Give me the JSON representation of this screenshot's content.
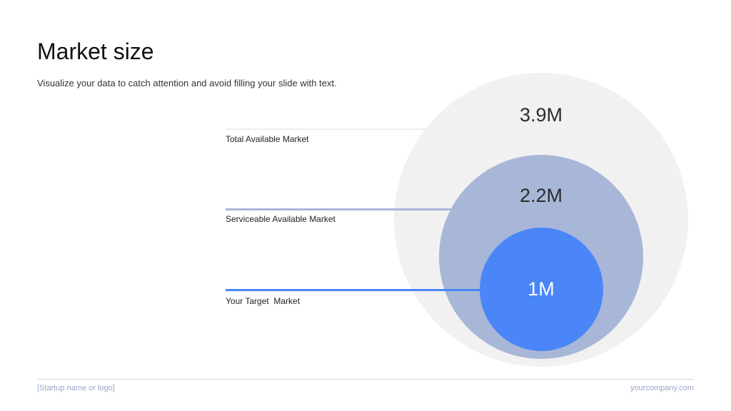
{
  "slide": {
    "title": "Market size",
    "subtitle": "Visualize your data to catch attention and avoid filling your slide with text."
  },
  "markets": [
    {
      "label": "Total Available Market",
      "value": "3.9M",
      "color": "#f1f1f1"
    },
    {
      "label": "Serviceable Available Market",
      "value": "2.2M",
      "color": "#a8b7d8"
    },
    {
      "label": "Your Target  Market",
      "value": "1M",
      "color": "#4a86f7"
    }
  ],
  "footer": {
    "left": "[Startup name or logo]",
    "right": "yourcompany.com"
  }
}
